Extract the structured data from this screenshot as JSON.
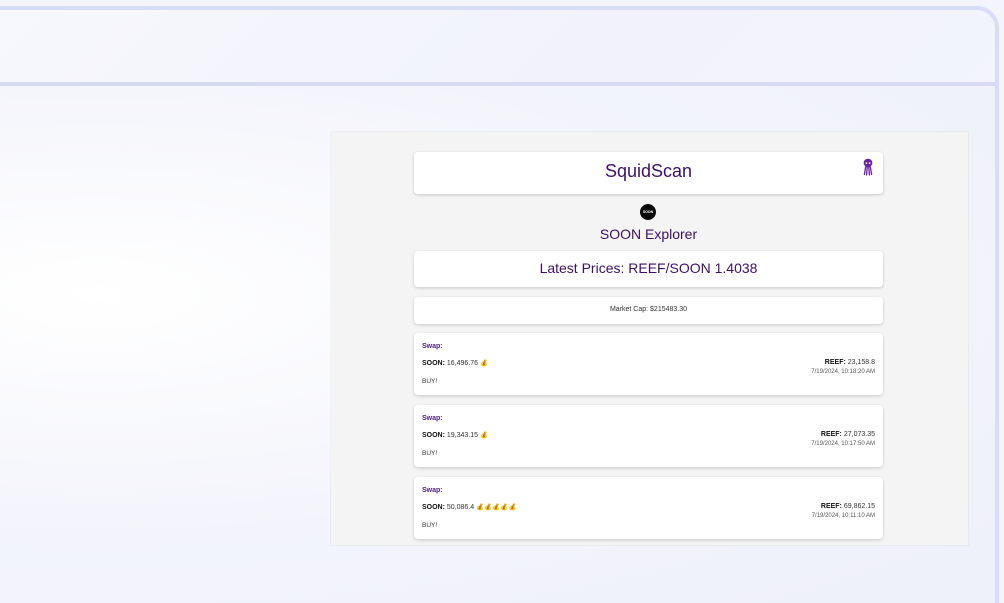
{
  "app": {
    "title": "SquidScan",
    "logo_icon": "squid-icon",
    "token_logo_text": "SOON",
    "explorer_title": "SOON Explorer"
  },
  "prices": {
    "label": "Latest Prices: REEF/SOON 1.4038"
  },
  "market": {
    "label": "Market Cap: $215483.30"
  },
  "swaps": [
    {
      "label": "Swap:",
      "soon_key": "SOON:",
      "soon_value": "16,496.76",
      "bags": "💰",
      "reef_key": "REEF:",
      "reef_value": "23,158.8",
      "timestamp": "7/19/2024, 10:18:20 AM",
      "action": "BUY!"
    },
    {
      "label": "Swap:",
      "soon_key": "SOON:",
      "soon_value": "19,343.15",
      "bags": "💰",
      "reef_key": "REEF:",
      "reef_value": "27,073.35",
      "timestamp": "7/19/2024, 10:17:50 AM",
      "action": "BUY!"
    },
    {
      "label": "Swap:",
      "soon_key": "SOON:",
      "soon_value": "50,086.4",
      "bags": "💰💰💰💰💰",
      "reef_key": "REEF:",
      "reef_value": "69,862.15",
      "timestamp": "7/19/2024, 10:11:10 AM",
      "action": "BUY!"
    }
  ],
  "colors": {
    "primary_text": "#3d1068",
    "accent": "#6a1fb0",
    "frame_border": "#d9dcf7"
  }
}
